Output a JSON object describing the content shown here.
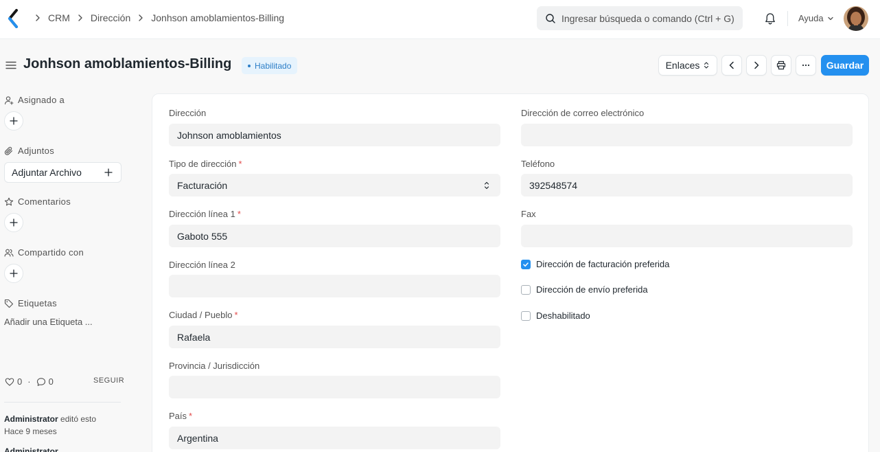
{
  "navbar": {
    "breadcrumbs": [
      "CRM",
      "Dirección",
      "Jonhson amoblamientos-Billing"
    ],
    "search_placeholder": "Ingresar búsqueda o comando (Ctrl + G)",
    "help_label": "Ayuda"
  },
  "page": {
    "title": "Jonhson amoblamientos-Billing",
    "status": "Habilitado",
    "status_color": "#2c7ec7"
  },
  "toolbar": {
    "links_label": "Enlaces",
    "save_label": "Guardar",
    "save_color": "#2490ef"
  },
  "sidebar": {
    "assigned_label": "Asignado a",
    "attachments_label": "Adjuntos",
    "attach_button": "Adjuntar Archivo",
    "comments_label": "Comentarios",
    "shared_label": "Compartido con",
    "tags_label": "Etiquetas",
    "add_tag": "Añadir una Etiqueta ...",
    "likes_count": "0",
    "comments_count": "0",
    "follow_label": "SEGUIR",
    "activity_user": "Administrator",
    "activity_action": " editó esto",
    "activity_time": "Hace 9 meses",
    "activity2_user": "Administrator"
  },
  "form": {
    "address_title": {
      "label": "Dirección",
      "value": "Johnson amoblamientos"
    },
    "address_type": {
      "label": "Tipo de dirección",
      "required": "*",
      "value": "Facturación"
    },
    "address_line1": {
      "label": "Dirección línea 1",
      "required": "*",
      "value": "Gaboto 555"
    },
    "address_line2": {
      "label": "Dirección línea 2",
      "value": ""
    },
    "city": {
      "label": "Ciudad / Pueblo",
      "required": "*",
      "value": "Rafaela"
    },
    "state": {
      "label": "Provincia / Jurisdicción",
      "value": ""
    },
    "country": {
      "label": "País",
      "required": "*",
      "value": "Argentina"
    },
    "email": {
      "label": "Dirección de correo electrónico",
      "value": ""
    },
    "phone": {
      "label": "Teléfono",
      "value": "392548574"
    },
    "fax": {
      "label": "Fax",
      "value": ""
    },
    "checks": [
      {
        "label": "Dirección de facturación preferida",
        "checked": true
      },
      {
        "label": "Dirección de envío preferida",
        "checked": false
      },
      {
        "label": "Deshabilitado",
        "checked": false
      }
    ]
  }
}
